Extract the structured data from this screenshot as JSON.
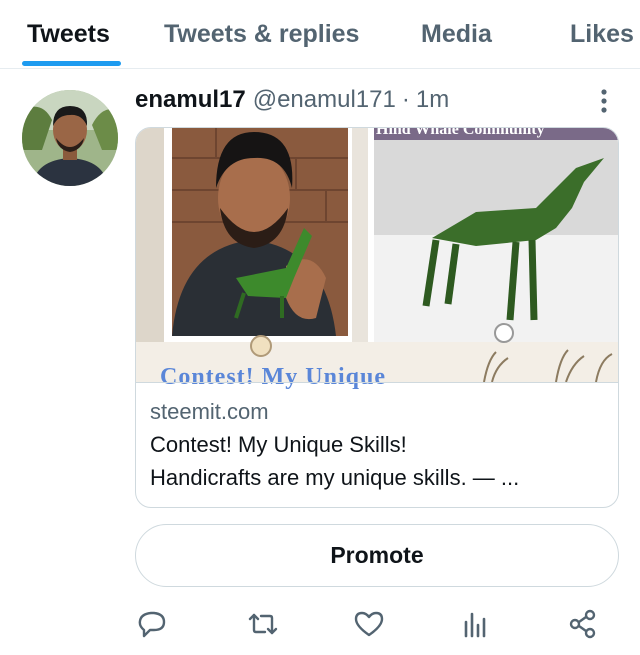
{
  "tabs": [
    {
      "label": "Tweets",
      "active": true
    },
    {
      "label": "Tweets & replies",
      "active": false
    },
    {
      "label": "Media",
      "active": false
    },
    {
      "label": "Likes",
      "active": false
    }
  ],
  "tweet": {
    "display_name": "enamul17",
    "handle": "@enamul171",
    "separator": "·",
    "time": "1m",
    "card": {
      "image_overlay_top": "Hind Whale Community",
      "image_overlay_bottom": "Contest! My Unique",
      "domain": "steemit.com",
      "title": "Contest! My Unique Skills!",
      "description": "Handicrafts are my unique skills. — ..."
    }
  },
  "promote_label": "Promote",
  "actions": [
    "reply-icon",
    "retweet-icon",
    "like-icon",
    "analytics-icon",
    "share-icon"
  ],
  "colors": {
    "accent": "#1d9bf0",
    "muted": "#536471",
    "text": "#0f1419",
    "border": "#cfd9de"
  }
}
